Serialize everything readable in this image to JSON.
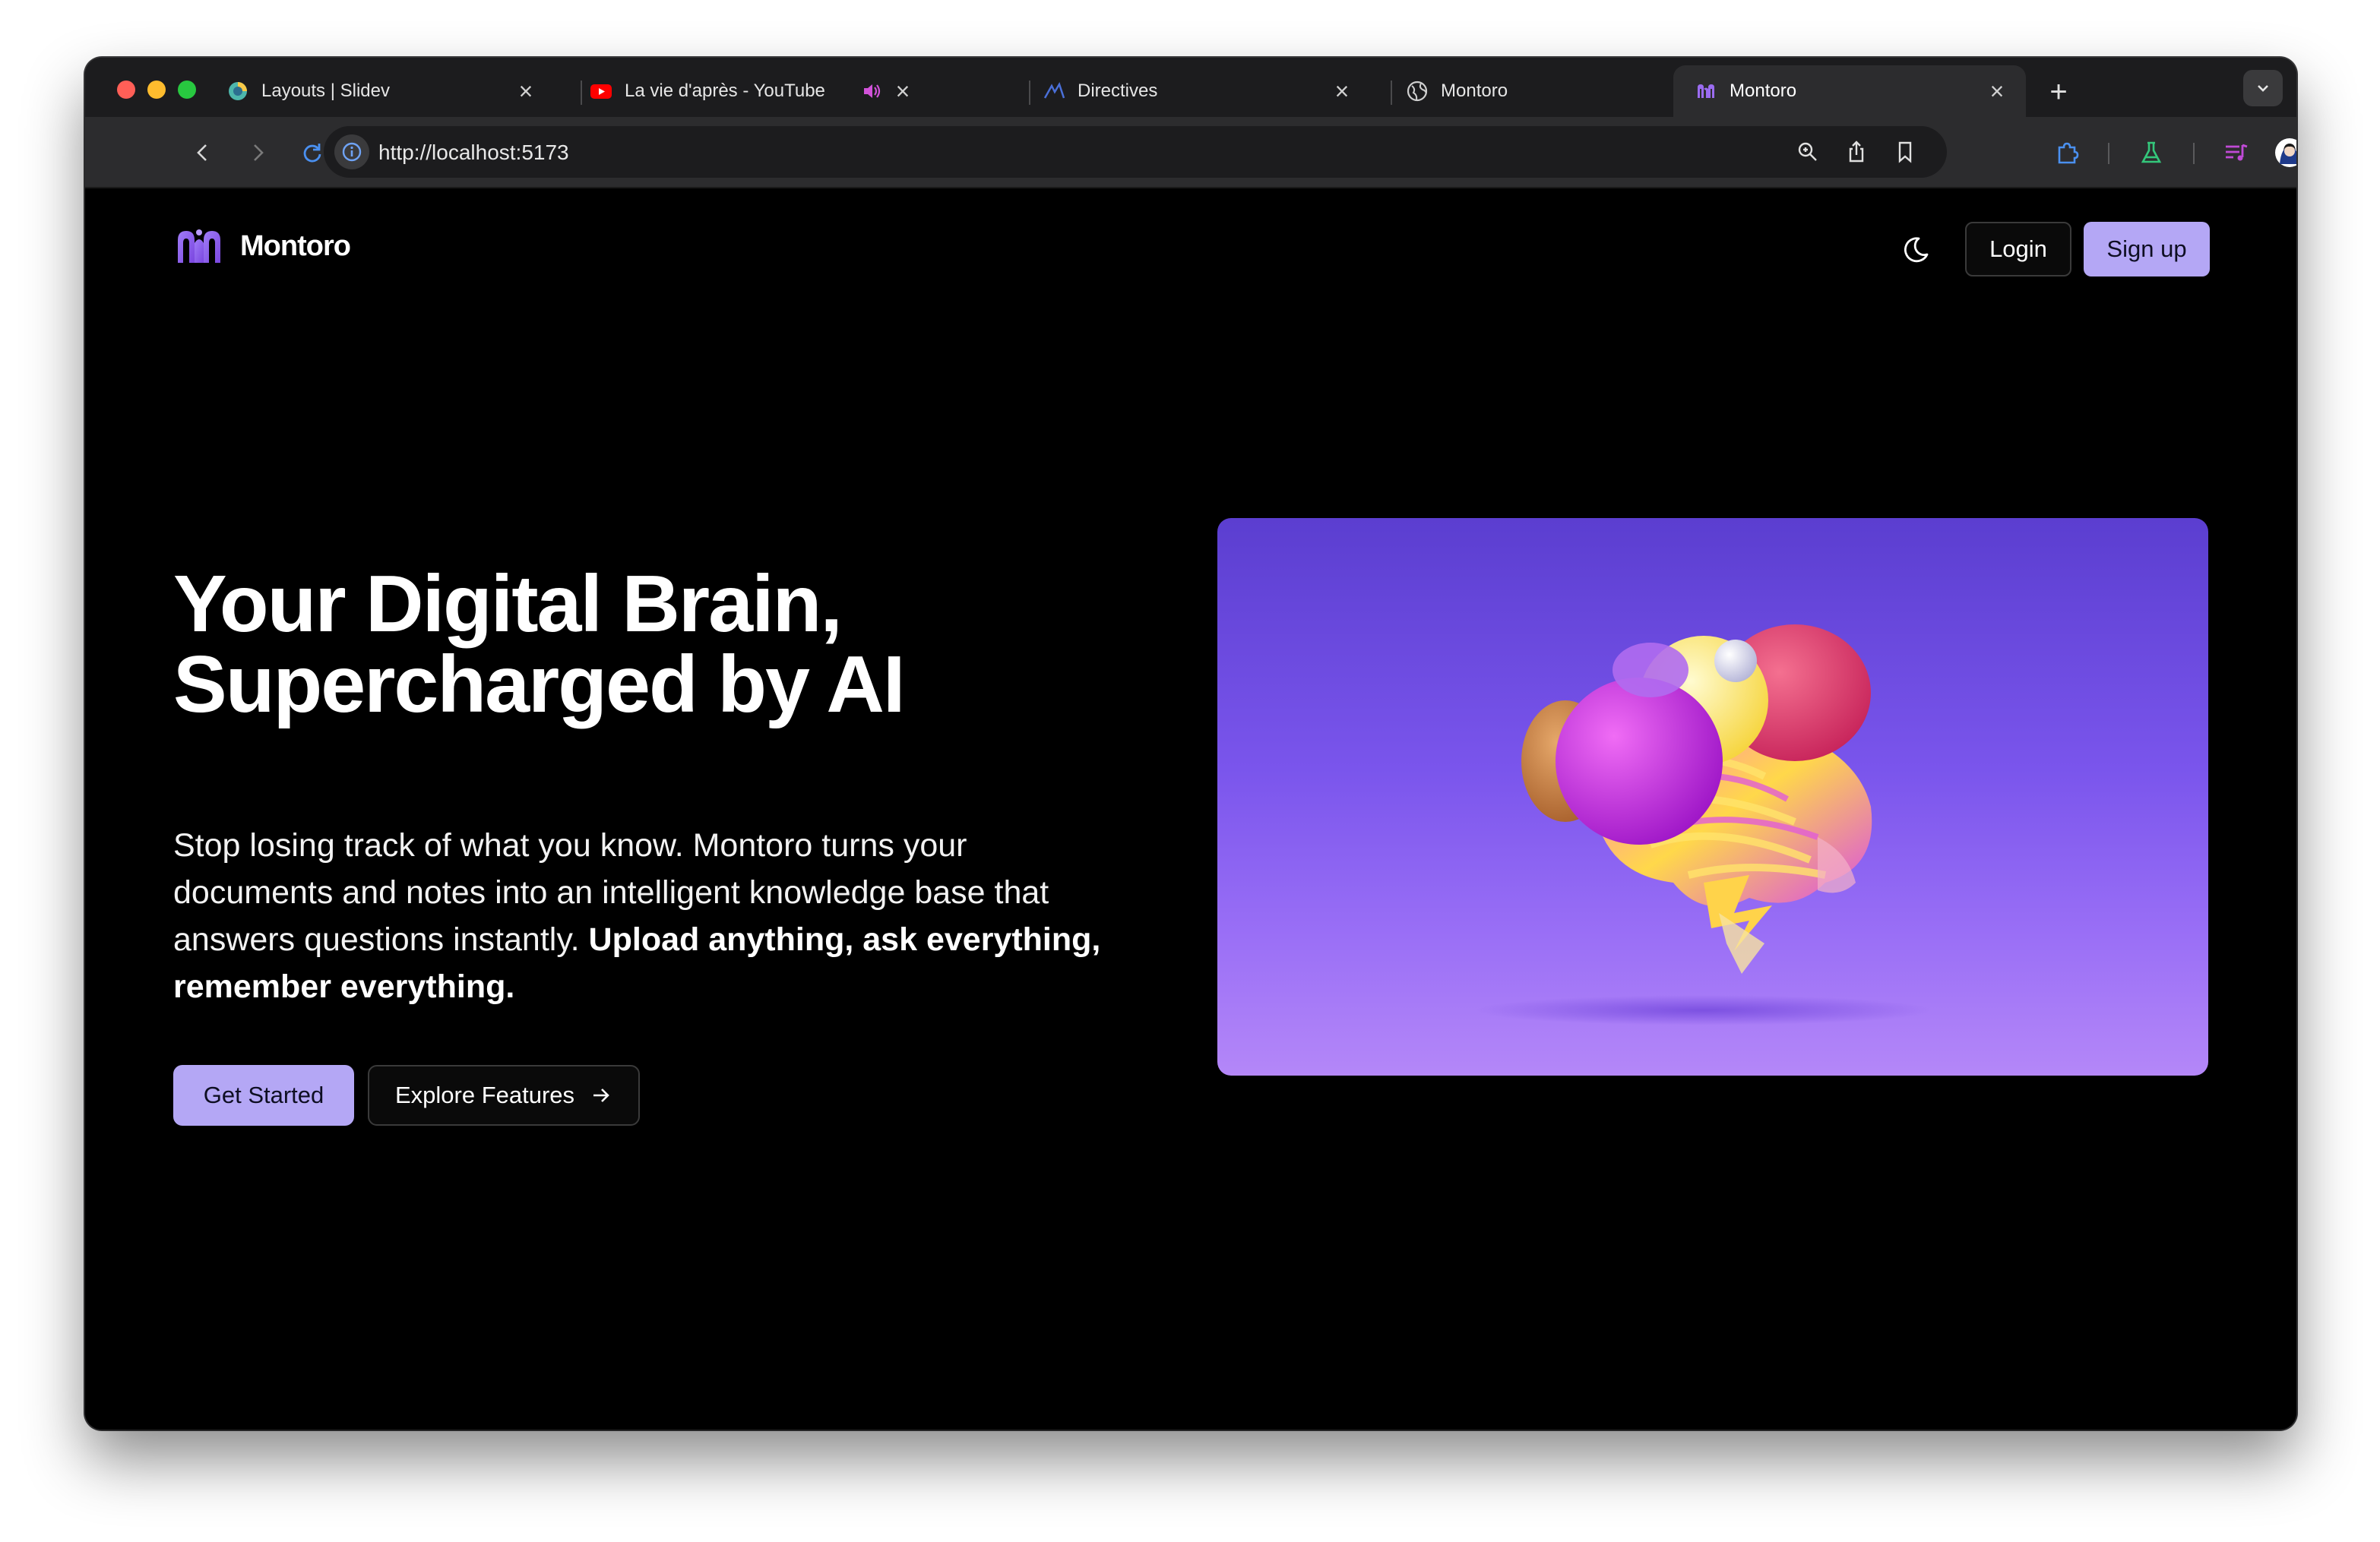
{
  "browser": {
    "tabs": [
      {
        "title": "Layouts | Slidev",
        "favicon": "slidev-icon",
        "active": false
      },
      {
        "title": "La vie d'après - YouTube",
        "favicon": "youtube-icon",
        "active": false,
        "audio": true
      },
      {
        "title": "Directives",
        "favicon": "directives-icon",
        "active": false
      },
      {
        "title": "Montoro",
        "favicon": "globe-icon",
        "active": false
      },
      {
        "title": "Montoro",
        "favicon": "montoro-icon",
        "active": true
      }
    ],
    "url": "http://localhost:5173"
  },
  "nav": {
    "brand": "Montoro",
    "login_label": "Login",
    "signup_label": "Sign up"
  },
  "hero": {
    "title_line1": "Your Digital Brain,",
    "title_line2": "Supercharged by AI",
    "description": "Stop losing track of what you know. Montoro turns your documents and notes into an intelligent knowledge base that answers questions instantly.",
    "description_bold": "Upload anything, ask everything, remember everything.",
    "primary_cta": "Get Started",
    "secondary_cta": "Explore Features"
  },
  "colors": {
    "accent": "#b4a7f5",
    "brand_purple": "#8b5cf6",
    "background": "#000000"
  }
}
